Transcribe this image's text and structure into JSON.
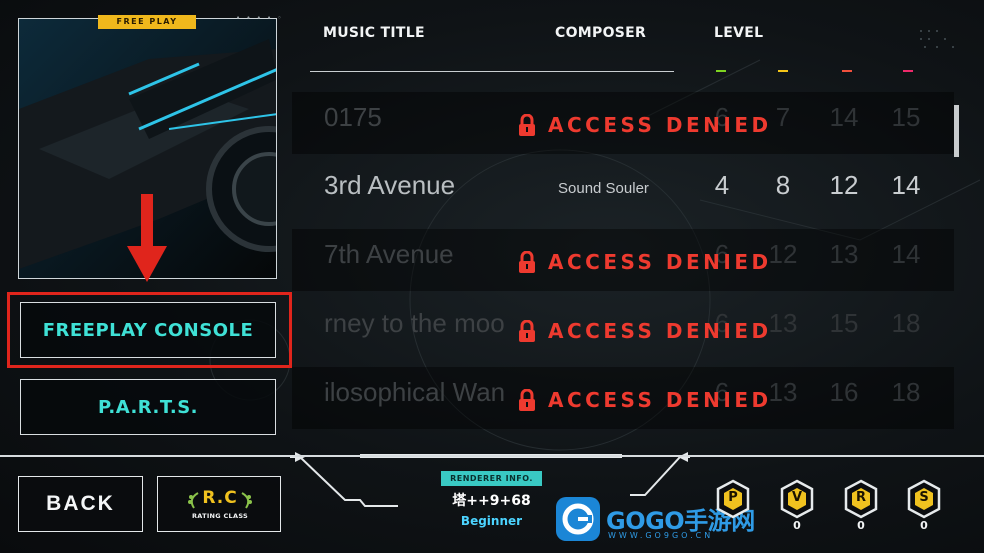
{
  "jacket": {
    "badge": "FREE PLAY",
    "dots": "• • • • ◦"
  },
  "menu": {
    "freeplay_label": "FREEPLAY CONSOLE",
    "parts_label": "P.A.R.T.S."
  },
  "header": {
    "music_title": "MUSIC TITLE",
    "composer": "COMPOSER",
    "level": "LEVEL"
  },
  "level_colors": [
    "#7ed321",
    "#f5c518",
    "#f0503c",
    "#ee2a6b"
  ],
  "songs": [
    {
      "title": "0175",
      "composer": "",
      "levels": [
        "6",
        "7",
        "14",
        "15"
      ],
      "locked": true,
      "status": "ACCESS DENIED"
    },
    {
      "title": "3rd Avenue",
      "composer": "Sound Souler",
      "levels": [
        "4",
        "8",
        "12",
        "14"
      ],
      "locked": false,
      "status": ""
    },
    {
      "title": "7th Avenue",
      "composer": "",
      "levels": [
        "6",
        "12",
        "13",
        "14"
      ],
      "locked": true,
      "status": "ACCESS DENIED"
    },
    {
      "title": "rney to the moo",
      "composer": "",
      "levels": [
        "6",
        "13",
        "15",
        "18"
      ],
      "locked": true,
      "status": "ACCESS DENIED"
    },
    {
      "title": "ilosophical Wan",
      "composer": "",
      "levels": [
        "6",
        "13",
        "16",
        "18"
      ],
      "locked": true,
      "status": "ACCESS DENIED"
    }
  ],
  "bottom": {
    "back_label": "BACK",
    "rating_main": "R.C",
    "rating_sub": "RATING CLASS",
    "renderer_badge": "RENDERER INFO.",
    "renderer_name": "塔++9+68",
    "renderer_rank": "Beginner"
  },
  "watermark": {
    "text": "GOGO手游网",
    "url": "WWW.GO9GO.CN"
  },
  "badges": [
    {
      "letter": "P",
      "count": ""
    },
    {
      "letter": "V",
      "count": "0"
    },
    {
      "letter": "R",
      "count": "0"
    },
    {
      "letter": "S",
      "count": "0"
    }
  ]
}
